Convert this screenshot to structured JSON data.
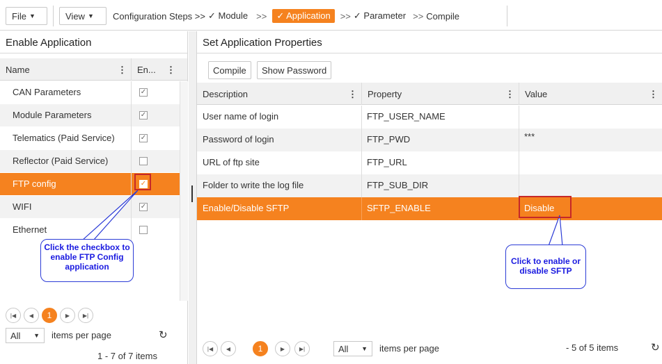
{
  "toolbar": {
    "file_label": "File",
    "view_label": "View",
    "steps": {
      "prefix": "Configuration Steps >>",
      "module": "✓ Module",
      "sep1": ">>",
      "application": "✓ Application",
      "sep2": ">>",
      "parameter": "✓ Parameter",
      "sep3": ">>",
      "compile": "Compile"
    }
  },
  "left": {
    "title": "Enable Application",
    "columns": {
      "name": "Name",
      "enabled": "En..."
    },
    "rows": [
      {
        "name": "CAN Parameters",
        "checked": true
      },
      {
        "name": "Module Parameters",
        "checked": true
      },
      {
        "name": "Telematics (Paid Service)",
        "checked": true
      },
      {
        "name": "Reflector (Paid Service)",
        "checked": false
      },
      {
        "name": "FTP config",
        "checked": true
      },
      {
        "name": "WIFI",
        "checked": true
      },
      {
        "name": "Ethernet",
        "checked": false
      }
    ],
    "callout": "Click the checkbox to enable FTP Config application",
    "pager": {
      "current_page": "1",
      "page_size": "All",
      "items_per_page": "items per page",
      "summary": "1 - 7 of 7 items"
    }
  },
  "right": {
    "title": "Set Application Properties",
    "compile_label": "Compile",
    "show_password_label": "Show Password",
    "columns": {
      "description": "Description",
      "property": "Property",
      "value": "Value"
    },
    "rows": [
      {
        "description": "User name of login",
        "property": "FTP_USER_NAME",
        "value": ""
      },
      {
        "description": "Password of login",
        "property": "FTP_PWD",
        "value": "***"
      },
      {
        "description": "URL of ftp site",
        "property": "FTP_URL",
        "value": ""
      },
      {
        "description": "Folder to write the log file",
        "property": "FTP_SUB_DIR",
        "value": ""
      },
      {
        "description": "Enable/Disable SFTP",
        "property": "SFTP_ENABLE",
        "value": "Disable"
      }
    ],
    "callout": "Click to enable or disable SFTP",
    "pager": {
      "current_page": "1",
      "page_size": "All",
      "items_per_page": "items per page",
      "summary": "- 5 of 5 items"
    }
  },
  "colors": {
    "accent": "#f5821f",
    "callout_text": "#1a1ae0",
    "highlight_border": "#c62828"
  }
}
